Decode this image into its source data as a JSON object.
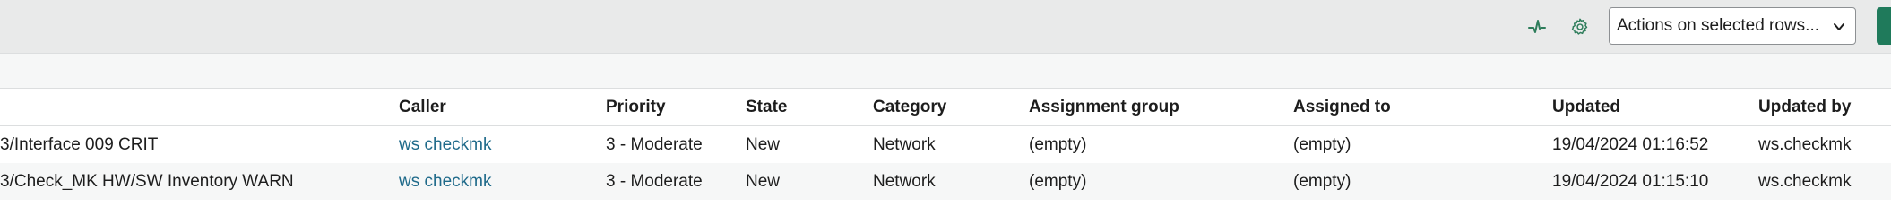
{
  "toolbar": {
    "activity_icon": "pulse-icon",
    "settings_icon": "gear-icon",
    "actions_select": {
      "selected": "Actions on selected rows..."
    },
    "colors": {
      "icon": "#2e7d5b",
      "primary": "#1f7a5b"
    }
  },
  "table": {
    "headers": {
      "caller": "Caller",
      "priority": "Priority",
      "state": "State",
      "category": "Category",
      "assignment_group": "Assignment group",
      "assigned_to": "Assigned to",
      "updated": "Updated",
      "updated_by": "Updated by"
    },
    "rows": [
      {
        "description": "3/Interface 009 CRIT",
        "caller": "ws checkmk",
        "priority": "3 - Moderate",
        "state": "New",
        "category": "Network",
        "assignment_group": "(empty)",
        "assigned_to": "(empty)",
        "updated": "19/04/2024 01:16:52",
        "updated_by": "ws.checkmk"
      },
      {
        "description": "3/Check_MK HW/SW Inventory WARN",
        "caller": "ws checkmk",
        "priority": "3 - Moderate",
        "state": "New",
        "category": "Network",
        "assignment_group": "(empty)",
        "assigned_to": "(empty)",
        "updated": "19/04/2024 01:15:10",
        "updated_by": "ws.checkmk"
      }
    ],
    "colors": {
      "link": "#1f6a8a",
      "zebra": "#f6f7f7"
    }
  }
}
